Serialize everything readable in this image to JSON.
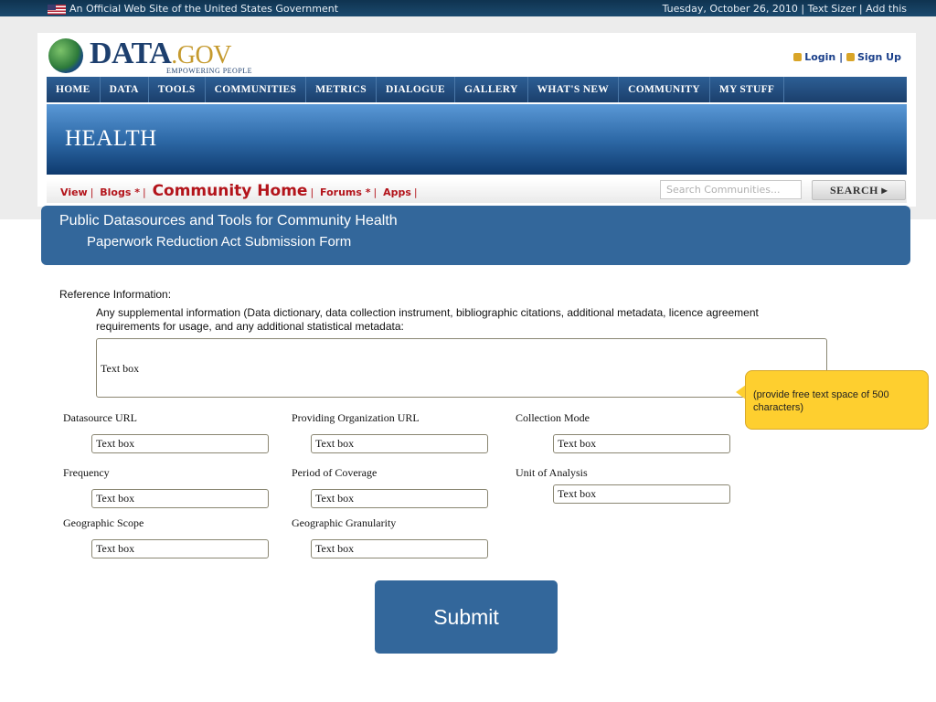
{
  "gov_bar": {
    "official": "An Official Web Site of the United States Government",
    "date": "Tuesday, October 26, 2010",
    "text_sizer": "Text Sizer",
    "add_this": "Add this"
  },
  "logo": {
    "data": "DATA",
    "gov": ".GOV",
    "tagline": "EMPOWERING PEOPLE"
  },
  "auth": {
    "login": "Login",
    "signup": "Sign Up"
  },
  "nav": [
    "HOME",
    "DATA",
    "TOOLS",
    "COMMUNITIES",
    "METRICS",
    "DIALOGUE",
    "GALLERY",
    "WHAT'S NEW",
    "COMMUNITY",
    "MY STUFF"
  ],
  "community": {
    "title": "HEALTH",
    "links": {
      "view": "View",
      "blogs": "Blogs *",
      "home": "Community Home",
      "forums": "Forums *",
      "apps": "Apps"
    },
    "search_placeholder": "Search Communities...",
    "search_button": "SEARCH"
  },
  "panel": {
    "title": "Public Datasources and Tools for Community Health",
    "subtitle": "Paperwork Reduction Act Submission Form"
  },
  "form": {
    "reference_label": "Reference Information:",
    "supplemental_desc": "Any supplemental information (Data dictionary, data collection instrument, bibliographic citations, additional metadata, licence agreement requirements for usage, and any additional statistical metadata:",
    "textbox": "Text box",
    "callout": "(provide free text space of 500 characters)",
    "fields": {
      "datasource_url": "Datasource URL",
      "providing_org_url": "Providing Organization URL",
      "collection_mode": "Collection Mode",
      "frequency": "Frequency",
      "period_of_coverage": "Period of Coverage",
      "unit_of_analysis": "Unit of Analysis",
      "geographic_scope": "Geographic Scope",
      "geographic_granularity": "Geographic Granularity"
    },
    "submit": "Submit"
  }
}
